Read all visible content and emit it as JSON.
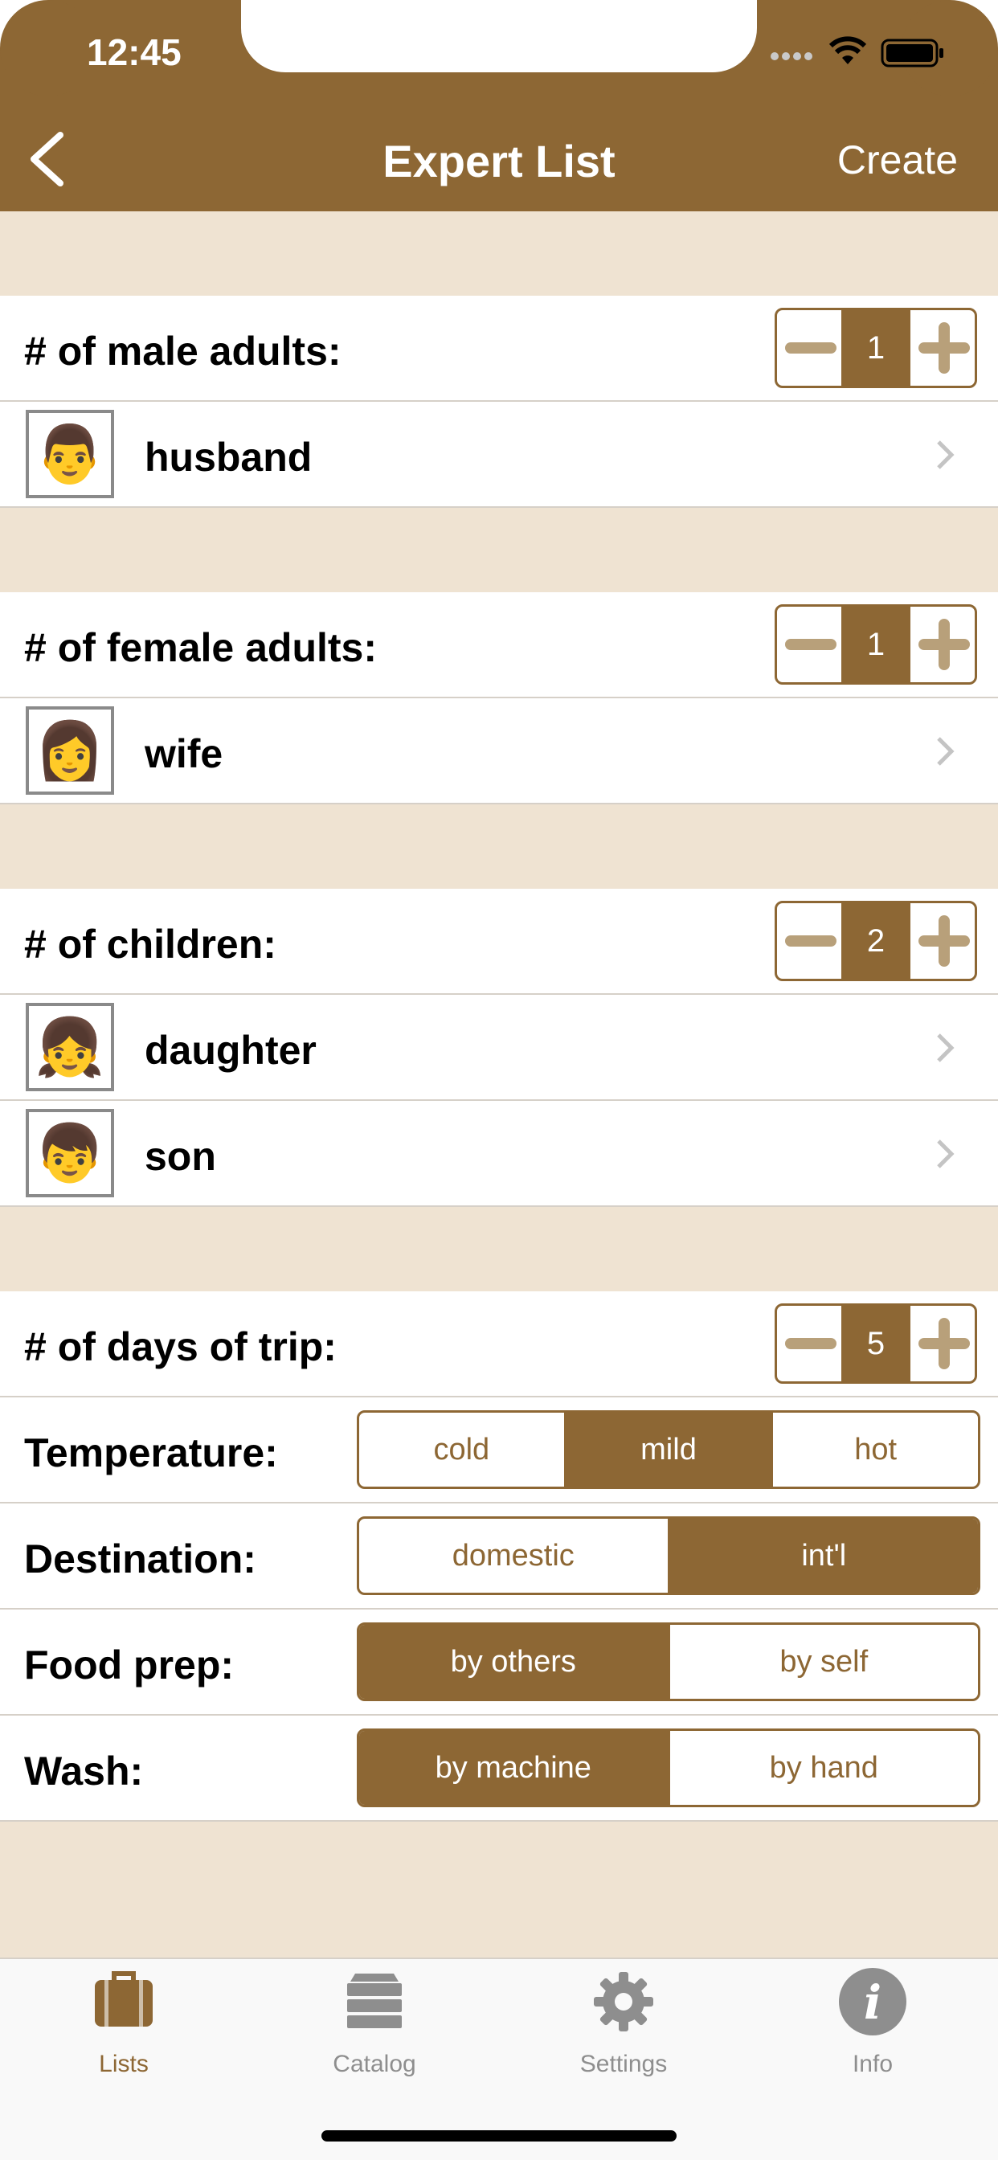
{
  "status": {
    "time": "12:45"
  },
  "nav": {
    "title": "Expert List",
    "action": "Create"
  },
  "sections": {
    "male": {
      "label": "# of male adults:",
      "count": "1",
      "items": [
        {
          "name": "husband",
          "emoji": "👨"
        }
      ]
    },
    "female": {
      "label": "# of female adults:",
      "count": "1",
      "items": [
        {
          "name": "wife",
          "emoji": "👩"
        }
      ]
    },
    "children": {
      "label": "# of children:",
      "count": "2",
      "items": [
        {
          "name": "daughter",
          "emoji": "👧"
        },
        {
          "name": "son",
          "emoji": "👦"
        }
      ]
    },
    "trip": {
      "days_label": "# of days of trip:",
      "days": "5",
      "temperature": {
        "label": "Temperature:",
        "options": [
          "cold",
          "mild",
          "hot"
        ],
        "selected": "mild"
      },
      "destination": {
        "label": "Destination:",
        "options": [
          "domestic",
          "int'l"
        ],
        "selected": "int'l"
      },
      "food": {
        "label": "Food prep:",
        "options": [
          "by others",
          "by self"
        ],
        "selected": "by others"
      },
      "wash": {
        "label": "Wash:",
        "options": [
          "by machine",
          "by hand"
        ],
        "selected": "by machine"
      }
    }
  },
  "tabs": [
    {
      "label": "Lists",
      "icon": "suitcase-icon",
      "active": true
    },
    {
      "label": "Catalog",
      "icon": "server-icon",
      "active": false
    },
    {
      "label": "Settings",
      "icon": "gear-icon",
      "active": false
    },
    {
      "label": "Info",
      "icon": "info-icon",
      "active": false
    }
  ],
  "colors": {
    "accent": "#8D6734",
    "background": "#EFE3D2"
  }
}
